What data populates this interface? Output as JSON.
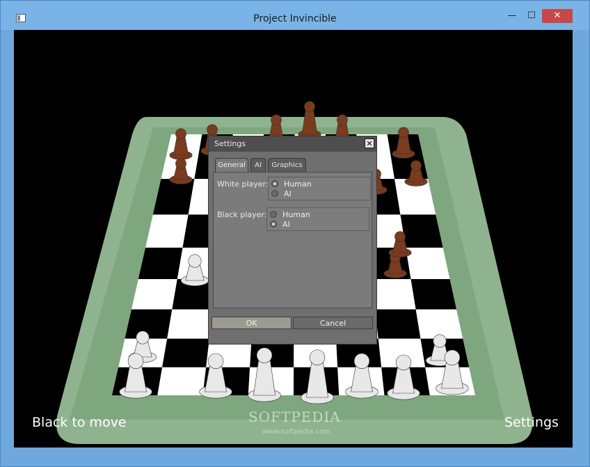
{
  "window": {
    "title": "Project Invincible",
    "minimize_glyph": "—",
    "maximize_glyph": "☐",
    "close_glyph": "✕"
  },
  "game": {
    "status": "Black to move",
    "settings_link": "Settings",
    "watermark": "SOFTPEDIA",
    "watermark_url": "www.softpedia.com",
    "colors": {
      "board_frame": "#8fb38f",
      "light_square": "#ffffff",
      "dark_square": "#000000",
      "black_piece": "#7a3b1e",
      "white_piece": "#e8e8e8"
    },
    "pieces": {
      "black": [
        "rook",
        "knight",
        "bishop",
        "queen",
        "king",
        "bishop",
        "knight",
        "rook",
        "pawn",
        "pawn",
        "pawn",
        "pawn",
        "pawn",
        "pawn",
        "pawn",
        "pawn"
      ],
      "white": [
        "rook",
        "knight",
        "bishop",
        "queen",
        "king",
        "bishop",
        "knight",
        "rook",
        "pawn",
        "pawn",
        "pawn"
      ]
    }
  },
  "dialog": {
    "title": "Settings",
    "close_glyph": "✕",
    "tabs": [
      {
        "label": "General",
        "active": true
      },
      {
        "label": "AI",
        "active": false
      },
      {
        "label": "Graphics",
        "active": false
      }
    ],
    "white_player": {
      "label": "White player:",
      "options": [
        {
          "label": "Human",
          "selected": true
        },
        {
          "label": "AI",
          "selected": false
        }
      ]
    },
    "black_player": {
      "label": "Black player:",
      "options": [
        {
          "label": "Human",
          "selected": false
        },
        {
          "label": "AI",
          "selected": true
        }
      ]
    },
    "ok_label": "OK",
    "cancel_label": "Cancel"
  }
}
